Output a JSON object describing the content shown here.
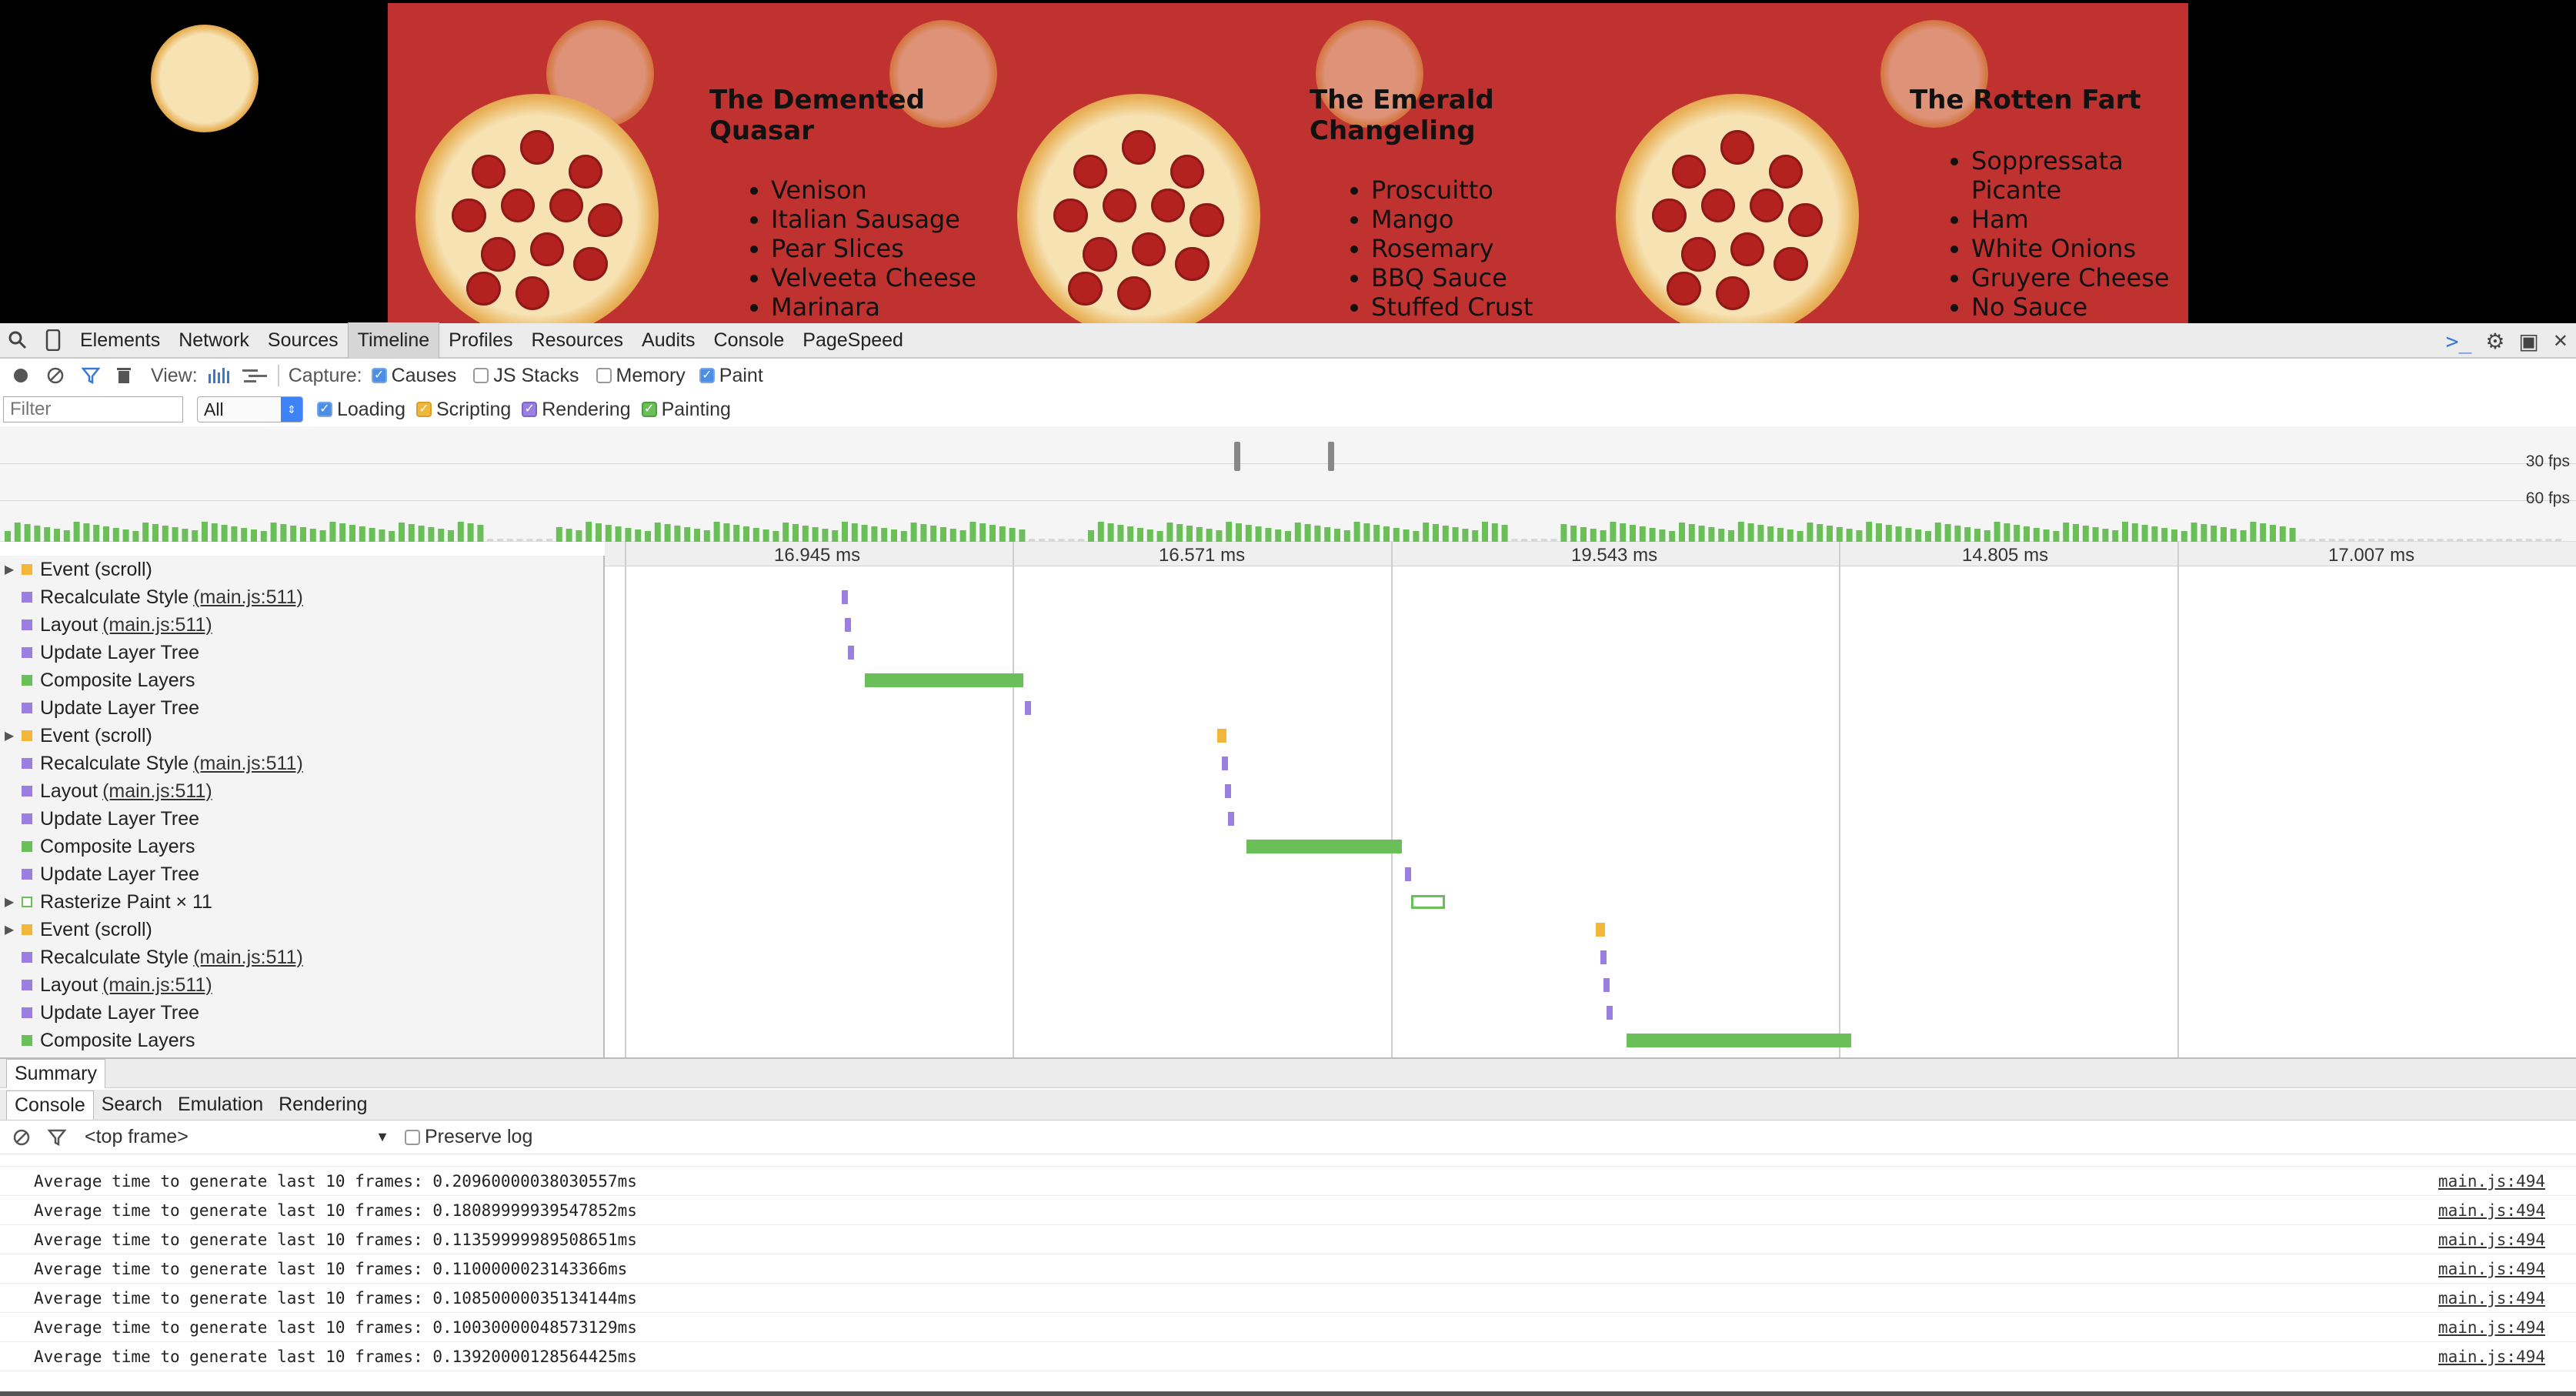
{
  "page": {
    "menus": [
      {
        "title_line1": "The Demented",
        "title_line2": "Quasar",
        "items": [
          "Venison",
          "Italian Sausage",
          "Pear Slices",
          "Velveeta Cheese",
          "Marinara"
        ]
      },
      {
        "title_line1": "The Emerald",
        "title_line2": "Changeling",
        "items": [
          "Proscuitto",
          "Mango",
          "Rosemary",
          "BBQ Sauce",
          "Stuffed Crust"
        ]
      },
      {
        "title_line1": "The Rotten Fart",
        "title_line2": "",
        "items": [
          "Soppressata",
          "Picante",
          "Ham",
          "White Onions",
          "Gruyere Cheese",
          "No Sauce"
        ]
      }
    ]
  },
  "devtools": {
    "tabs": [
      "Elements",
      "Network",
      "Sources",
      "Timeline",
      "Profiles",
      "Resources",
      "Audits",
      "Console",
      "PageSpeed"
    ],
    "active_tab": "Timeline",
    "toolbar": {
      "view_label": "View:",
      "capture_label": "Capture:",
      "causes": "Causes",
      "js_stacks": "JS Stacks",
      "memory": "Memory",
      "paint": "Paint"
    },
    "filter_bar": {
      "filter_placeholder": "Filter",
      "select_value": "All",
      "loading": "Loading",
      "scripting": "Scripting",
      "rendering": "Rendering",
      "painting": "Painting"
    },
    "overview": {
      "fps_30": "30 fps",
      "fps_60": "60 fps"
    },
    "frame_times": [
      "16.945 ms",
      "16.571 ms",
      "19.543 ms",
      "14.805 ms",
      "17.007 ms"
    ],
    "records": [
      {
        "label": "Event (scroll)",
        "link": "",
        "kind": "scripting",
        "expandable": true
      },
      {
        "label": "Recalculate Style",
        "link": "(main.js:511)",
        "kind": "rendering",
        "expandable": false
      },
      {
        "label": "Layout",
        "link": "(main.js:511)",
        "kind": "rendering",
        "expandable": false
      },
      {
        "label": "Update Layer Tree",
        "link": "",
        "kind": "rendering",
        "expandable": false
      },
      {
        "label": "Composite Layers",
        "link": "",
        "kind": "painting",
        "expandable": false
      },
      {
        "label": "Update Layer Tree",
        "link": "",
        "kind": "rendering",
        "expandable": false
      },
      {
        "label": "Event (scroll)",
        "link": "",
        "kind": "scripting",
        "expandable": true
      },
      {
        "label": "Recalculate Style",
        "link": "(main.js:511)",
        "kind": "rendering",
        "expandable": false
      },
      {
        "label": "Layout",
        "link": "(main.js:511)",
        "kind": "rendering",
        "expandable": false
      },
      {
        "label": "Update Layer Tree",
        "link": "",
        "kind": "rendering",
        "expandable": false
      },
      {
        "label": "Composite Layers",
        "link": "",
        "kind": "painting",
        "expandable": false
      },
      {
        "label": "Update Layer Tree",
        "link": "",
        "kind": "rendering",
        "expandable": false
      },
      {
        "label": "Rasterize Paint × 11",
        "link": "",
        "kind": "painting-outline",
        "expandable": true
      },
      {
        "label": "Event (scroll)",
        "link": "",
        "kind": "scripting",
        "expandable": true
      },
      {
        "label": "Recalculate Style",
        "link": "(main.js:511)",
        "kind": "rendering",
        "expandable": false
      },
      {
        "label": "Layout",
        "link": "(main.js:511)",
        "kind": "rendering",
        "expandable": false
      },
      {
        "label": "Update Layer Tree",
        "link": "",
        "kind": "rendering",
        "expandable": false
      },
      {
        "label": "Composite Layers",
        "link": "",
        "kind": "painting",
        "expandable": false
      }
    ],
    "summary_tab": "Summary",
    "drawer_tabs": [
      "Console",
      "Search",
      "Emulation",
      "Rendering"
    ],
    "console": {
      "frame_select": "<top frame>",
      "preserve_log": "Preserve log",
      "messages": [
        {
          "text": "Average time to generate last 10 frames: 0.20960000038030557ms",
          "source": "main.js:494"
        },
        {
          "text": "Average time to generate last 10 frames: 0.18089999939547852ms",
          "source": "main.js:494"
        },
        {
          "text": "Average time to generate last 10 frames: 0.11359999989508651ms",
          "source": "main.js:494"
        },
        {
          "text": "Average time to generate last 10 frames: 0.1100000023143366ms",
          "source": "main.js:494"
        },
        {
          "text": "Average time to generate last 10 frames: 0.10850000035134144ms",
          "source": "main.js:494"
        },
        {
          "text": "Average time to generate last 10 frames: 0.10030000048573129ms",
          "source": "main.js:494"
        },
        {
          "text": "Average time to generate last 10 frames: 0.13920000128564425ms",
          "source": "main.js:494"
        }
      ]
    },
    "colors": {
      "scripting": "#f2b63b",
      "rendering": "#9b7fe0",
      "painting": "#6bbf59",
      "banner": "#c0322f"
    }
  }
}
